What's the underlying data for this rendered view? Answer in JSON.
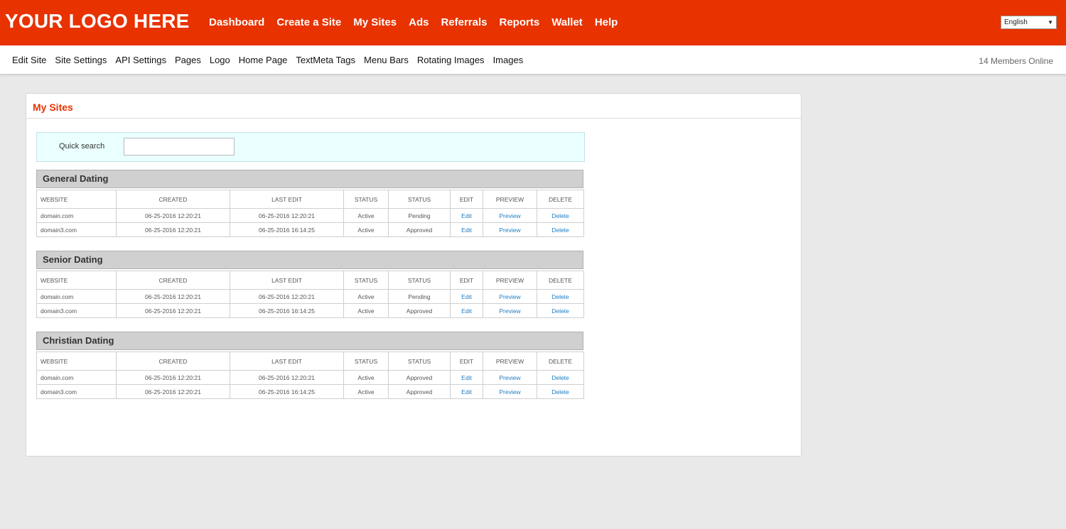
{
  "header": {
    "logo": "YOUR LOGO HERE",
    "nav": [
      "Dashboard",
      "Create a Site",
      "My Sites",
      "Ads",
      "Referrals",
      "Reports",
      "Wallet",
      "Help"
    ],
    "language": "English"
  },
  "subnav": {
    "items": [
      "Edit Site",
      "Site Settings",
      "API Settings",
      "Pages",
      "Logo",
      "Home Page",
      "TextMeta Tags",
      "Menu Bars",
      "Rotating Images",
      "Images"
    ],
    "online": "14 Members Online"
  },
  "panel": {
    "title": "My Sites",
    "search_label": "Quick search",
    "search_value": ""
  },
  "columns": [
    "WEBSITE",
    "CREATED",
    "LAST EDIT",
    "STATUS",
    "STATUS",
    "EDIT",
    "PREVIEW",
    "DELETE"
  ],
  "groups": [
    {
      "title": "General Dating",
      "rows": [
        {
          "website": "domain.com",
          "created": "06-25-2016 12:20:21",
          "last_edit": "06-25-2016 12:20:21",
          "status": "Active",
          "approval": "Pending",
          "edit": "Edit",
          "preview": "Preview",
          "delete": "Delete"
        },
        {
          "website": "domain3.com",
          "created": "06-25-2016 12:20:21",
          "last_edit": "06-25-2016 16:14:25",
          "status": "Active",
          "approval": "Approved",
          "edit": "Edit",
          "preview": "Preview",
          "delete": "Delete"
        }
      ]
    },
    {
      "title": "Senior Dating",
      "rows": [
        {
          "website": "domain.com",
          "created": "06-25-2016 12:20:21",
          "last_edit": "06-25-2016 12:20:21",
          "status": "Active",
          "approval": "Pending",
          "edit": "Edit",
          "preview": "Preview",
          "delete": "Delete"
        },
        {
          "website": "domain3.com",
          "created": "06-25-2016 12:20:21",
          "last_edit": "06-25-2016 16:14:25",
          "status": "Active",
          "approval": "Approved",
          "edit": "Edit",
          "preview": "Preview",
          "delete": "Delete"
        }
      ]
    },
    {
      "title": "Christian Dating",
      "rows": [
        {
          "website": "domain.com",
          "created": "06-25-2016 12:20:21",
          "last_edit": "06-25-2016 12:20:21",
          "status": "Active",
          "approval": "Approved",
          "edit": "Edit",
          "preview": "Preview",
          "delete": "Delete"
        },
        {
          "website": "domain3.com",
          "created": "06-25-2016 12:20:21",
          "last_edit": "06-25-2016 16:14:25",
          "status": "Active",
          "approval": "Approved",
          "edit": "Edit",
          "preview": "Preview",
          "delete": "Delete"
        }
      ]
    }
  ],
  "colors": {
    "brand": "#e83200",
    "link": "#1a7ec8",
    "search_bg": "#eaffff"
  }
}
